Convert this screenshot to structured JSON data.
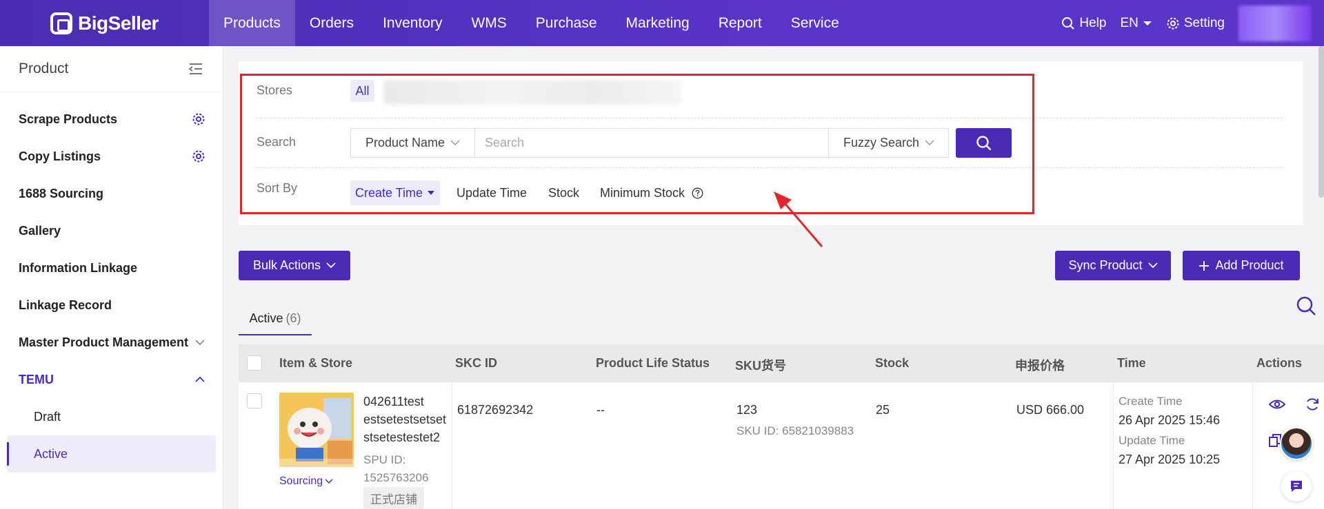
{
  "brand": "BigSeller",
  "nav": {
    "items": [
      "Products",
      "Orders",
      "Inventory",
      "WMS",
      "Purchase",
      "Marketing",
      "Report",
      "Service"
    ],
    "help": "Help",
    "lang": "EN",
    "setting": "Setting"
  },
  "sidebar": {
    "title": "Product",
    "items": {
      "scrape": "Scrape Products",
      "copy": "Copy Listings",
      "sourcing1688": "1688 Sourcing",
      "gallery": "Gallery",
      "linkage": "Information Linkage",
      "linkage_record": "Linkage Record",
      "master": "Master Product Management",
      "temu": "TEMU",
      "draft": "Draft",
      "active": "Active"
    }
  },
  "filters": {
    "stores_label": "Stores",
    "stores_all": "All",
    "search_label": "Search",
    "search_field": "Product Name",
    "search_placeholder": "Search",
    "search_mode": "Fuzzy Search",
    "sort_label": "Sort By",
    "sort_options": [
      "Create Time",
      "Update Time",
      "Stock",
      "Minimum Stock"
    ]
  },
  "actions": {
    "bulk": "Bulk Actions",
    "sync": "Sync Product",
    "add": "Add Product"
  },
  "tabs": {
    "active_label": "Active",
    "active_count": "(6)"
  },
  "table": {
    "headers": [
      "Item & Store",
      "SKC ID",
      "Product Life Status",
      "SKU货号",
      "Stock",
      "申报价格",
      "Time",
      "Actions"
    ],
    "rows": [
      {
        "title_lines": [
          "042611test",
          "estsetestsetset",
          "stsetestestet2"
        ],
        "spu_label": "SPU ID:",
        "spu_id": "1525763206",
        "store_badge": "正式店铺",
        "sourcing": "Sourcing",
        "skc_id": "61872692342",
        "life_status": "--",
        "sku": "123",
        "sku_id": "SKU ID: 65821039883",
        "stock": "25",
        "price": "USD 666.00",
        "create_label": "Create Time",
        "create_time": "26 Apr 2025 15:46",
        "update_label": "Update Time",
        "update_time": "27 Apr 2025 10:25"
      }
    ]
  },
  "colors": {
    "primary": "#4b2ab5",
    "highlight_box": "#e3262b"
  }
}
